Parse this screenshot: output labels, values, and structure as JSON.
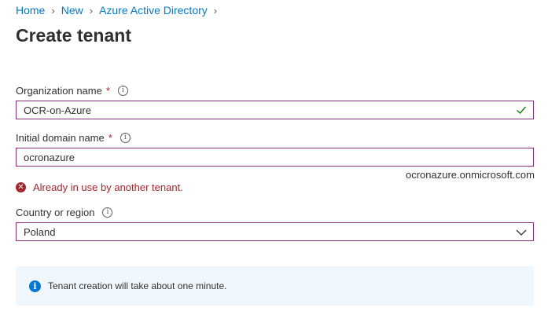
{
  "breadcrumb": [
    "Home",
    "New",
    "Azure Active Directory"
  ],
  "page_title": "Create tenant",
  "org": {
    "label": "Organization name",
    "required": "*",
    "value": "OCR-on-Azure"
  },
  "domain": {
    "label": "Initial domain name",
    "required": "*",
    "value": "ocronazure",
    "suffix": "ocronazure.onmicrosoft.com",
    "error": "Already in use by another tenant."
  },
  "country": {
    "label": "Country or region",
    "value": "Poland"
  },
  "notice": {
    "text": "Tenant creation will take about one minute."
  },
  "colors": {
    "link": "#0078d4",
    "field_border": "#8a2c7a",
    "error": "#a4262c",
    "valid_check": "#107c10",
    "notice_bg": "#eff6fc"
  },
  "icons": [
    "chevron-right-icon",
    "info-icon",
    "checkmark-icon",
    "error-icon",
    "chevron-down-icon"
  ]
}
